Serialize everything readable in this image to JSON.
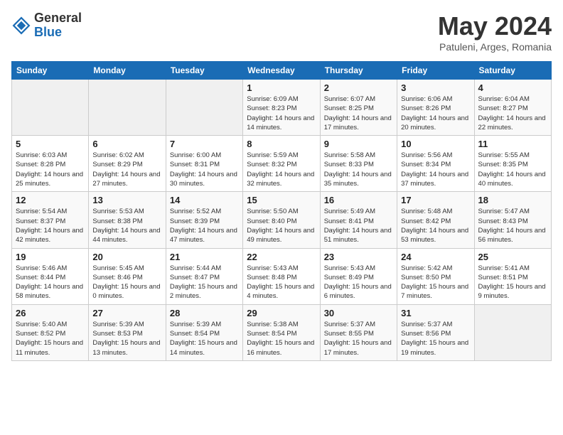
{
  "header": {
    "logo_general": "General",
    "logo_blue": "Blue",
    "month_title": "May 2024",
    "location": "Patuleni, Arges, Romania"
  },
  "days_of_week": [
    "Sunday",
    "Monday",
    "Tuesday",
    "Wednesday",
    "Thursday",
    "Friday",
    "Saturday"
  ],
  "weeks": [
    [
      {
        "day": "",
        "sunrise": "",
        "sunset": "",
        "daylight": "",
        "empty": true
      },
      {
        "day": "",
        "sunrise": "",
        "sunset": "",
        "daylight": "",
        "empty": true
      },
      {
        "day": "",
        "sunrise": "",
        "sunset": "",
        "daylight": "",
        "empty": true
      },
      {
        "day": "1",
        "sunrise": "Sunrise: 6:09 AM",
        "sunset": "Sunset: 8:23 PM",
        "daylight": "Daylight: 14 hours and 14 minutes.",
        "empty": false
      },
      {
        "day": "2",
        "sunrise": "Sunrise: 6:07 AM",
        "sunset": "Sunset: 8:25 PM",
        "daylight": "Daylight: 14 hours and 17 minutes.",
        "empty": false
      },
      {
        "day": "3",
        "sunrise": "Sunrise: 6:06 AM",
        "sunset": "Sunset: 8:26 PM",
        "daylight": "Daylight: 14 hours and 20 minutes.",
        "empty": false
      },
      {
        "day": "4",
        "sunrise": "Sunrise: 6:04 AM",
        "sunset": "Sunset: 8:27 PM",
        "daylight": "Daylight: 14 hours and 22 minutes.",
        "empty": false
      }
    ],
    [
      {
        "day": "5",
        "sunrise": "Sunrise: 6:03 AM",
        "sunset": "Sunset: 8:28 PM",
        "daylight": "Daylight: 14 hours and 25 minutes.",
        "empty": false
      },
      {
        "day": "6",
        "sunrise": "Sunrise: 6:02 AM",
        "sunset": "Sunset: 8:29 PM",
        "daylight": "Daylight: 14 hours and 27 minutes.",
        "empty": false
      },
      {
        "day": "7",
        "sunrise": "Sunrise: 6:00 AM",
        "sunset": "Sunset: 8:31 PM",
        "daylight": "Daylight: 14 hours and 30 minutes.",
        "empty": false
      },
      {
        "day": "8",
        "sunrise": "Sunrise: 5:59 AM",
        "sunset": "Sunset: 8:32 PM",
        "daylight": "Daylight: 14 hours and 32 minutes.",
        "empty": false
      },
      {
        "day": "9",
        "sunrise": "Sunrise: 5:58 AM",
        "sunset": "Sunset: 8:33 PM",
        "daylight": "Daylight: 14 hours and 35 minutes.",
        "empty": false
      },
      {
        "day": "10",
        "sunrise": "Sunrise: 5:56 AM",
        "sunset": "Sunset: 8:34 PM",
        "daylight": "Daylight: 14 hours and 37 minutes.",
        "empty": false
      },
      {
        "day": "11",
        "sunrise": "Sunrise: 5:55 AM",
        "sunset": "Sunset: 8:35 PM",
        "daylight": "Daylight: 14 hours and 40 minutes.",
        "empty": false
      }
    ],
    [
      {
        "day": "12",
        "sunrise": "Sunrise: 5:54 AM",
        "sunset": "Sunset: 8:37 PM",
        "daylight": "Daylight: 14 hours and 42 minutes.",
        "empty": false
      },
      {
        "day": "13",
        "sunrise": "Sunrise: 5:53 AM",
        "sunset": "Sunset: 8:38 PM",
        "daylight": "Daylight: 14 hours and 44 minutes.",
        "empty": false
      },
      {
        "day": "14",
        "sunrise": "Sunrise: 5:52 AM",
        "sunset": "Sunset: 8:39 PM",
        "daylight": "Daylight: 14 hours and 47 minutes.",
        "empty": false
      },
      {
        "day": "15",
        "sunrise": "Sunrise: 5:50 AM",
        "sunset": "Sunset: 8:40 PM",
        "daylight": "Daylight: 14 hours and 49 minutes.",
        "empty": false
      },
      {
        "day": "16",
        "sunrise": "Sunrise: 5:49 AM",
        "sunset": "Sunset: 8:41 PM",
        "daylight": "Daylight: 14 hours and 51 minutes.",
        "empty": false
      },
      {
        "day": "17",
        "sunrise": "Sunrise: 5:48 AM",
        "sunset": "Sunset: 8:42 PM",
        "daylight": "Daylight: 14 hours and 53 minutes.",
        "empty": false
      },
      {
        "day": "18",
        "sunrise": "Sunrise: 5:47 AM",
        "sunset": "Sunset: 8:43 PM",
        "daylight": "Daylight: 14 hours and 56 minutes.",
        "empty": false
      }
    ],
    [
      {
        "day": "19",
        "sunrise": "Sunrise: 5:46 AM",
        "sunset": "Sunset: 8:44 PM",
        "daylight": "Daylight: 14 hours and 58 minutes.",
        "empty": false
      },
      {
        "day": "20",
        "sunrise": "Sunrise: 5:45 AM",
        "sunset": "Sunset: 8:46 PM",
        "daylight": "Daylight: 15 hours and 0 minutes.",
        "empty": false
      },
      {
        "day": "21",
        "sunrise": "Sunrise: 5:44 AM",
        "sunset": "Sunset: 8:47 PM",
        "daylight": "Daylight: 15 hours and 2 minutes.",
        "empty": false
      },
      {
        "day": "22",
        "sunrise": "Sunrise: 5:43 AM",
        "sunset": "Sunset: 8:48 PM",
        "daylight": "Daylight: 15 hours and 4 minutes.",
        "empty": false
      },
      {
        "day": "23",
        "sunrise": "Sunrise: 5:43 AM",
        "sunset": "Sunset: 8:49 PM",
        "daylight": "Daylight: 15 hours and 6 minutes.",
        "empty": false
      },
      {
        "day": "24",
        "sunrise": "Sunrise: 5:42 AM",
        "sunset": "Sunset: 8:50 PM",
        "daylight": "Daylight: 15 hours and 7 minutes.",
        "empty": false
      },
      {
        "day": "25",
        "sunrise": "Sunrise: 5:41 AM",
        "sunset": "Sunset: 8:51 PM",
        "daylight": "Daylight: 15 hours and 9 minutes.",
        "empty": false
      }
    ],
    [
      {
        "day": "26",
        "sunrise": "Sunrise: 5:40 AM",
        "sunset": "Sunset: 8:52 PM",
        "daylight": "Daylight: 15 hours and 11 minutes.",
        "empty": false
      },
      {
        "day": "27",
        "sunrise": "Sunrise: 5:39 AM",
        "sunset": "Sunset: 8:53 PM",
        "daylight": "Daylight: 15 hours and 13 minutes.",
        "empty": false
      },
      {
        "day": "28",
        "sunrise": "Sunrise: 5:39 AM",
        "sunset": "Sunset: 8:54 PM",
        "daylight": "Daylight: 15 hours and 14 minutes.",
        "empty": false
      },
      {
        "day": "29",
        "sunrise": "Sunrise: 5:38 AM",
        "sunset": "Sunset: 8:54 PM",
        "daylight": "Daylight: 15 hours and 16 minutes.",
        "empty": false
      },
      {
        "day": "30",
        "sunrise": "Sunrise: 5:37 AM",
        "sunset": "Sunset: 8:55 PM",
        "daylight": "Daylight: 15 hours and 17 minutes.",
        "empty": false
      },
      {
        "day": "31",
        "sunrise": "Sunrise: 5:37 AM",
        "sunset": "Sunset: 8:56 PM",
        "daylight": "Daylight: 15 hours and 19 minutes.",
        "empty": false
      },
      {
        "day": "",
        "sunrise": "",
        "sunset": "",
        "daylight": "",
        "empty": true
      }
    ]
  ]
}
